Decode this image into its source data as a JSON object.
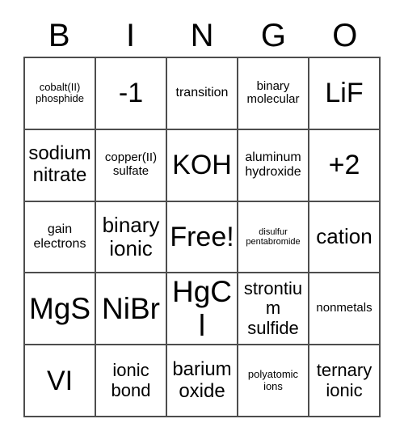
{
  "card": {
    "title_letters": [
      "B",
      "I",
      "N",
      "G",
      "O"
    ],
    "free_space_label": "Free!",
    "columns": 5,
    "rows": 5,
    "border_color": "#4d4d4d",
    "background_color": "#ffffff",
    "text_color": "#000000",
    "cells": [
      [
        {
          "text": "cobalt(II) phosphide",
          "size": "sm"
        },
        {
          "text": "-1",
          "size": "4xl"
        },
        {
          "text": "transition",
          "size": "lg"
        },
        {
          "text": "binary molecular",
          "size": "md"
        },
        {
          "text": "LiF",
          "size": "4xl"
        }
      ],
      [
        {
          "text": "sodium nitrate",
          "size": "2xl"
        },
        {
          "text": "copper(II) sulfate",
          "size": "md"
        },
        {
          "text": "KOH",
          "size": "4xl"
        },
        {
          "text": "aluminum hydroxide",
          "size": "lg"
        },
        {
          "text": "+2",
          "size": "4xl"
        }
      ],
      [
        {
          "text": "gain electrons",
          "size": "lg"
        },
        {
          "text": "binary ionic",
          "size": "3xl"
        },
        {
          "text": "Free!",
          "size": "4xl"
        },
        {
          "text": "disulfur pentabromide",
          "size": "xs"
        },
        {
          "text": "cation",
          "size": "3xl"
        }
      ],
      [
        {
          "text": "MgS",
          "size": "5xl"
        },
        {
          "text": "NiBr",
          "size": "5xl"
        },
        {
          "text": "HgCl",
          "size": "5xl"
        },
        {
          "text": "strontium sulfide",
          "size": "xl"
        },
        {
          "text": "nonmetals",
          "size": "md"
        }
      ],
      [
        {
          "text": "VI",
          "size": "4xl"
        },
        {
          "text": "ionic bond",
          "size": "xl"
        },
        {
          "text": "barium oxide",
          "size": "2xl"
        },
        {
          "text": "polyatomic ions",
          "size": "sm"
        },
        {
          "text": "ternary ionic",
          "size": "xl"
        }
      ]
    ]
  }
}
